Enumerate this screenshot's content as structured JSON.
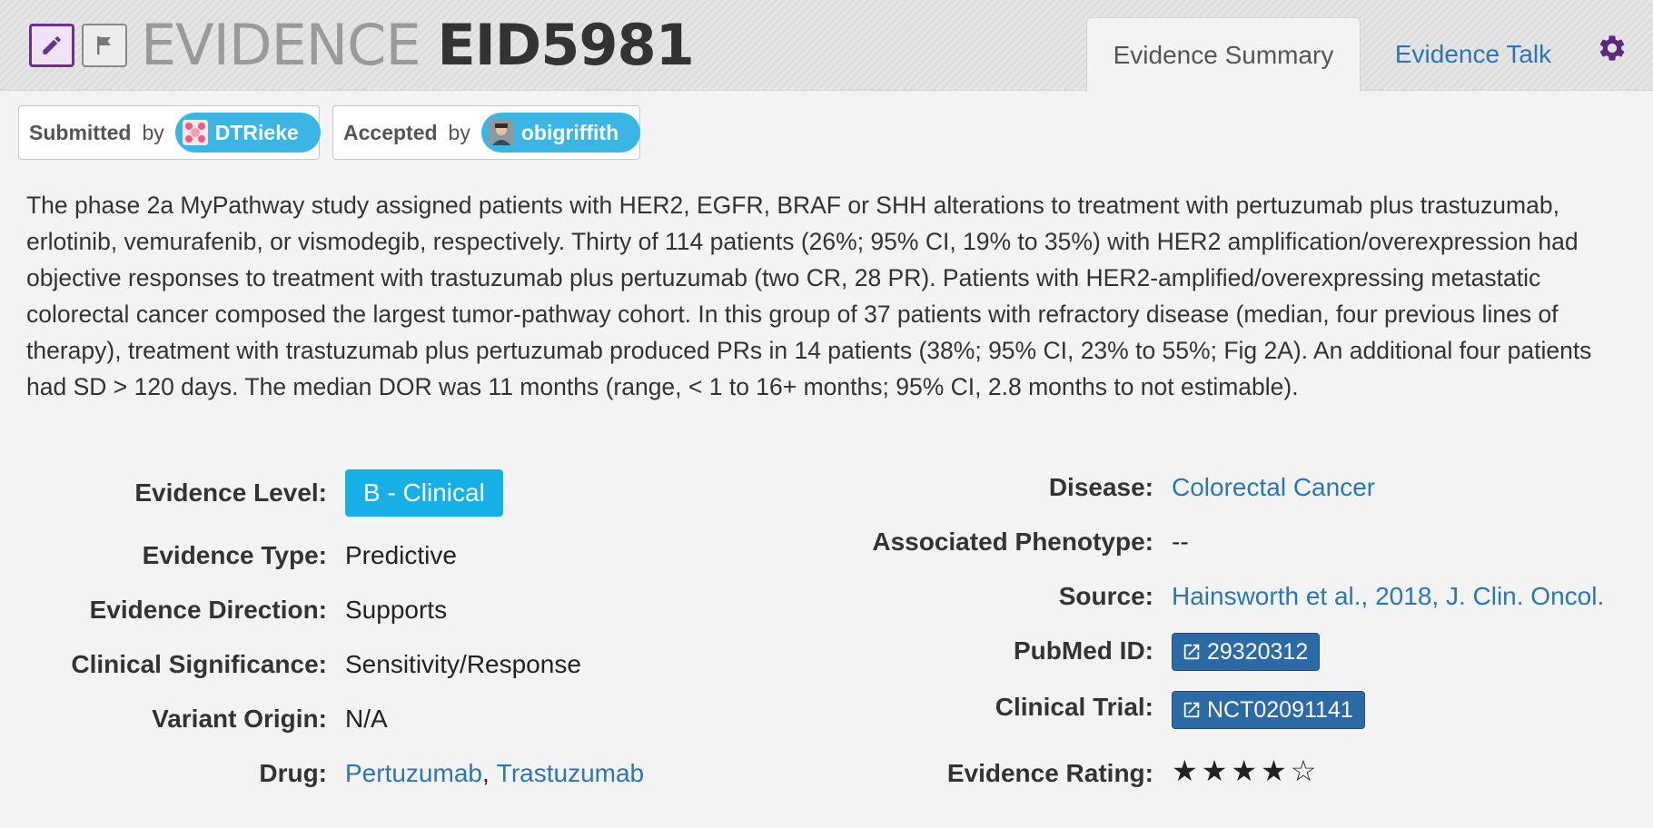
{
  "header": {
    "title_prefix": "EVIDENCE",
    "title_id": "EID5981",
    "tabs": [
      {
        "label": "Evidence Summary",
        "active": true
      },
      {
        "label": "Evidence Talk",
        "active": false
      }
    ],
    "icons": [
      "pencil-icon",
      "flag-icon",
      "gear-icon"
    ],
    "colors": {
      "accent": "#6a3093",
      "link": "#2a76b6",
      "pill": "#3bb6e4"
    }
  },
  "attribution": {
    "submitted": {
      "role": "Submitted",
      "by": "by",
      "user": "DTRieke"
    },
    "accepted": {
      "role": "Accepted",
      "by": "by",
      "user": "obigriffith"
    }
  },
  "description": "The phase 2a MyPathway study assigned patients with HER2, EGFR, BRAF or SHH alterations to treatment with pertuzumab plus trastuzumab, erlotinib, vemurafenib, or vismodegib, respectively. Thirty of 114 patients (26%; 95% CI, 19% to 35%) with HER2 amplification/overexpression had objective responses to treatment with trastuzumab plus pertuzumab (two CR, 28 PR). Patients with HER2-amplified/overexpressing metastatic colorectal cancer composed the largest tumor-pathway cohort. In this group of 37 patients with refractory disease (median, four previous lines of therapy), treatment with trastuzumab plus pertuzumab produced PRs in 14 patients (38%; 95% CI, 23% to 55%; Fig 2A). An additional four patients had SD > 120 days. The median DOR was 11 months (range, < 1 to 16+ months; 95% CI, 2.8 months to not estimable).",
  "left_fields": {
    "evidence_level": {
      "label": "Evidence Level:",
      "value": "B - Clinical"
    },
    "evidence_type": {
      "label": "Evidence Type:",
      "value": "Predictive"
    },
    "evidence_direction": {
      "label": "Evidence Direction:",
      "value": "Supports"
    },
    "clinical_significance": {
      "label": "Clinical Significance:",
      "value": "Sensitivity/Response"
    },
    "variant_origin": {
      "label": "Variant Origin:",
      "value": "N/A"
    },
    "drug": {
      "label": "Drug:",
      "values": [
        "Pertuzumab",
        "Trastuzumab"
      ],
      "separator": ","
    }
  },
  "right_fields": {
    "disease": {
      "label": "Disease:",
      "value": "Colorectal Cancer"
    },
    "phenotype": {
      "label": "Associated Phenotype:",
      "value": "--"
    },
    "source": {
      "label": "Source:",
      "value": "Hainsworth et al., 2018, J. Clin. Oncol."
    },
    "pubmed": {
      "label": "PubMed ID:",
      "value": "29320312"
    },
    "clinical_trial": {
      "label": "Clinical Trial:",
      "value": "NCT02091141"
    },
    "rating": {
      "label": "Evidence Rating:",
      "value": 4,
      "max": 5
    }
  }
}
